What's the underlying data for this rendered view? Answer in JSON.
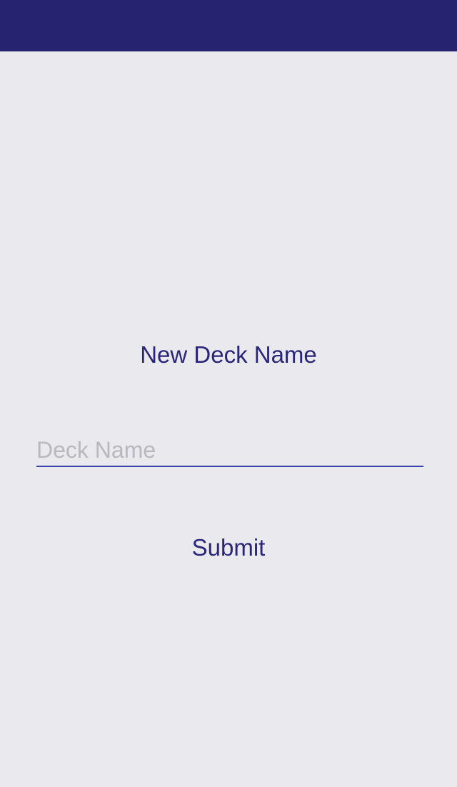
{
  "theme": {
    "header_color": "#262470",
    "background_color": "#eae9ee",
    "accent_text_color": "#29267a",
    "underline_color": "#3b3fb0",
    "placeholder_color": "#b9b8bf"
  },
  "form": {
    "title": "New Deck Name",
    "deck_name_input": {
      "value": "",
      "placeholder": "Deck Name"
    },
    "submit_label": "Submit"
  }
}
